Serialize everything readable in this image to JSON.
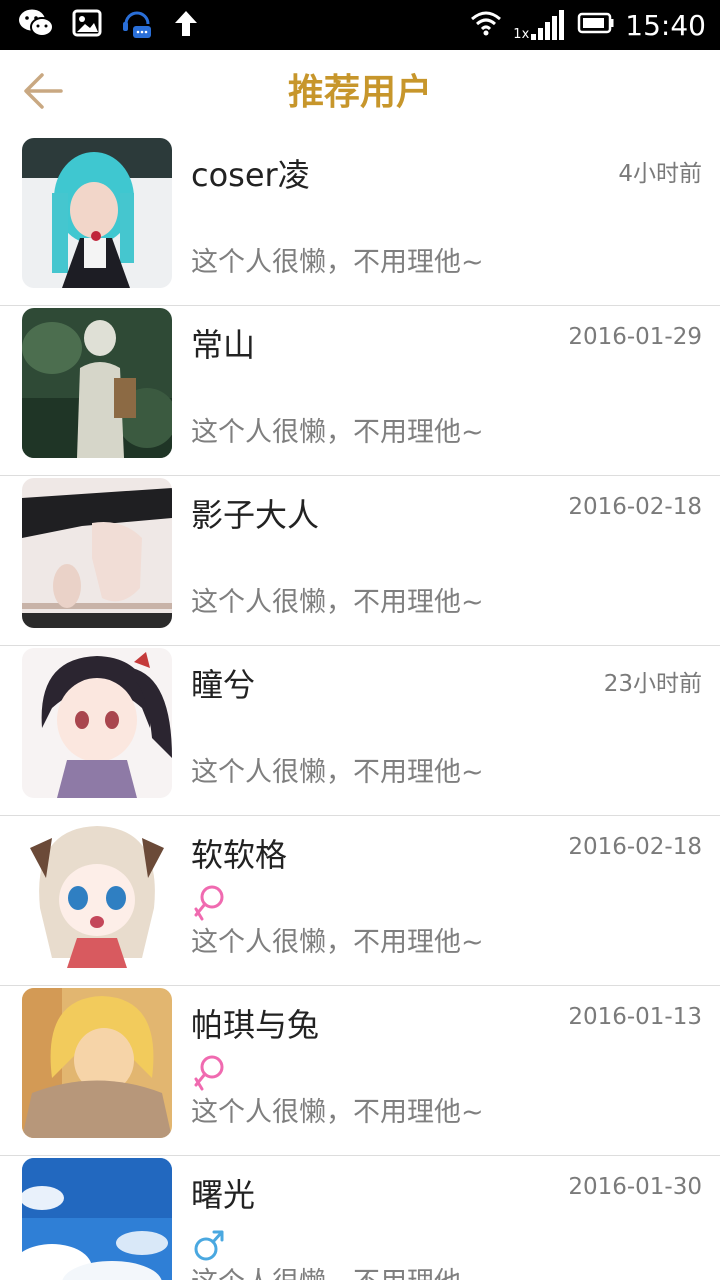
{
  "status_bar": {
    "time": "15:40",
    "network_label": "1x",
    "icons": [
      "wechat-icon",
      "gallery-icon",
      "chat-support-icon",
      "upload-arrow-icon",
      "wifi-icon",
      "cellular-signal-icon",
      "battery-icon"
    ]
  },
  "header": {
    "title": "推荐用户",
    "back_icon": "back-arrow-icon"
  },
  "colors": {
    "accent": "#c7962b",
    "back_arrow": "#c9a882",
    "female": "#f06ab0",
    "male": "#4aa8e0",
    "divider": "#dddddd"
  },
  "users": [
    {
      "name": "coser凌",
      "time": "4小时前",
      "signature": "这个人很懒，不用理他~",
      "gender": ""
    },
    {
      "name": "常山",
      "time": "2016-01-29",
      "signature": "这个人很懒，不用理他~",
      "gender": ""
    },
    {
      "name": "影子大人",
      "time": "2016-02-18",
      "signature": "这个人很懒，不用理他~",
      "gender": ""
    },
    {
      "name": "瞳兮",
      "time": "23小时前",
      "signature": "这个人很懒，不用理他~",
      "gender": ""
    },
    {
      "name": "软软格",
      "time": "2016-02-18",
      "signature": "这个人很懒，不用理他~",
      "gender": "female"
    },
    {
      "name": "帕琪与兔",
      "time": "2016-01-13",
      "signature": "这个人很懒，不用理他~",
      "gender": "female"
    },
    {
      "name": "曙光",
      "time": "2016-01-30",
      "signature": "这个人很懒，不用理他~",
      "gender": "male"
    }
  ]
}
